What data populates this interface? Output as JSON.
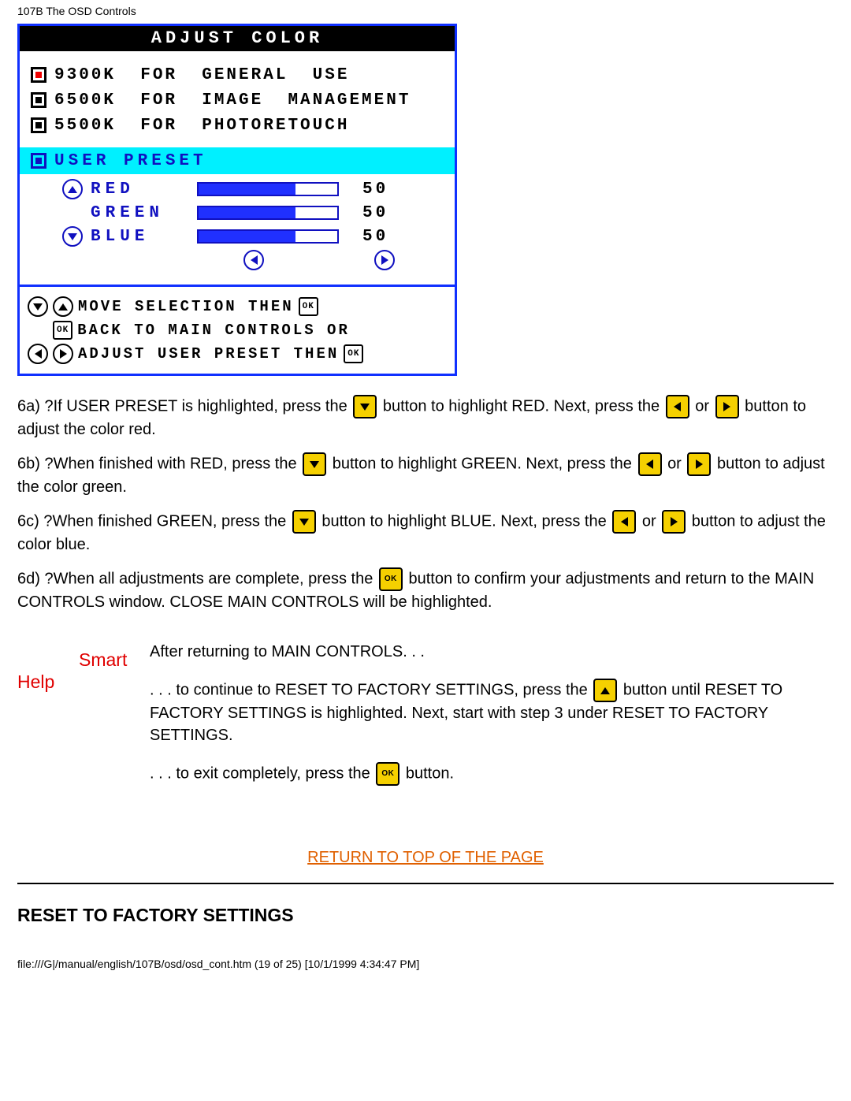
{
  "page_header": "107B The OSD Controls",
  "osd": {
    "title": "ADJUST  COLOR",
    "options": [
      {
        "label": "9300K  FOR  GENERAL  USE",
        "selected": true
      },
      {
        "label": "6500K  FOR  IMAGE  MANAGEMENT",
        "selected": false
      },
      {
        "label": "5500K  FOR  PHOTORETOUCH",
        "selected": false
      }
    ],
    "user_preset_label": "USER  PRESET",
    "rgb": {
      "red": {
        "label": "RED",
        "value": "50"
      },
      "green": {
        "label": "GREEN",
        "value": "50"
      },
      "blue": {
        "label": "BLUE",
        "value": "50"
      }
    },
    "footer": {
      "line1": "MOVE  SELECTION  THEN",
      "line2a": "BACK  TO  MAIN  CONTROLS  OR",
      "line3": "ADJUST  USER  PRESET  THEN"
    }
  },
  "instr": {
    "p6a_a": "6a) ?If USER PRESET is highlighted, press the ",
    "p6a_b": " button to highlight RED. Next, press the ",
    "p6a_c": " or ",
    "p6a_d": " button to adjust the color red.",
    "p6b_a": "6b) ?When finished with RED, press the ",
    "p6b_b": " button to highlight GREEN. Next, press the ",
    "p6b_c": " or ",
    "p6b_d": " button to adjust the color green.",
    "p6c_a": "6c) ?When finished GREEN, press the ",
    "p6c_b": " button to highlight BLUE. Next, press the ",
    "p6c_c": " or ",
    "p6c_d": " button to adjust the color blue.",
    "p6d_a": "6d) ?When all adjustments are complete, press the ",
    "p6d_b": " button to confirm your adjustments and return to the MAIN CONTROLS window. CLOSE MAIN CONTROLS will be highlighted."
  },
  "smart_help": {
    "label1": "Smart",
    "label2": "Help",
    "after": "After returning to MAIN CONTROLS. . .",
    "cont_a": ". . . to continue to RESET TO FACTORY SETTINGS, press the ",
    "cont_b": " button until RESET TO FACTORY SETTINGS is highlighted. Next, start with step 3 under RESET TO FACTORY SETTINGS.",
    "exit_a": ". . . to exit completely, press the ",
    "exit_b": " button."
  },
  "top_link": "RETURN TO TOP OF THE PAGE",
  "section_heading": "RESET TO FACTORY SETTINGS",
  "footer_line": "file:///G|/manual/english/107B/osd/osd_cont.htm (19 of 25) [10/1/1999 4:34:47 PM]"
}
